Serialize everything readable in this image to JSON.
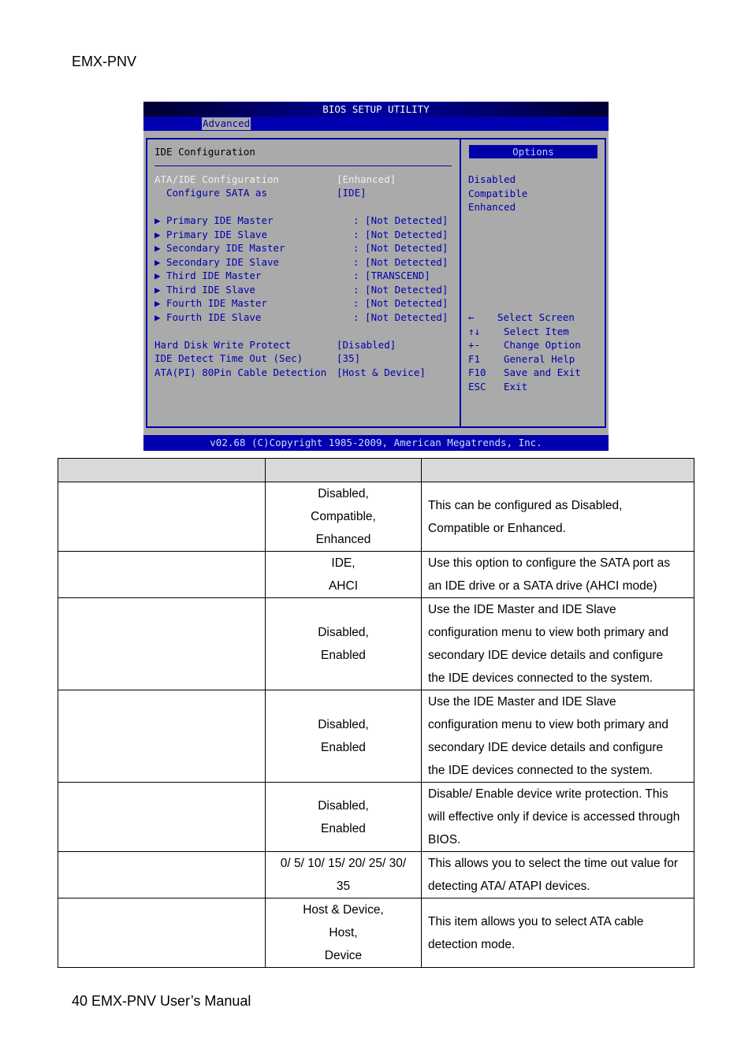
{
  "header": "EMX-PNV",
  "footer": "40 EMX-PNV User’s Manual",
  "bios": {
    "title": "BIOS SETUP UTILITY",
    "tab": "Advanced",
    "section_title": "IDE Configuration",
    "items": [
      {
        "label": "ATA/IDE Configuration",
        "value": "[Enhanced]",
        "selected": true
      },
      {
        "label": "  Configure SATA as",
        "value": "[IDE]"
      },
      {
        "label": "▶ Primary IDE Master",
        "value": ": [Not Detected]"
      },
      {
        "label": "▶ Primary IDE Slave",
        "value": ": [Not Detected]"
      },
      {
        "label": "▶ Secondary IDE Master",
        "value": ": [Not Detected]"
      },
      {
        "label": "▶ Secondary IDE Slave",
        "value": ": [Not Detected]"
      },
      {
        "label": "▶ Third IDE Master",
        "value": ": [TRANSCEND]"
      },
      {
        "label": "▶ Third IDE Slave",
        "value": ": [Not Detected]"
      },
      {
        "label": "▶ Fourth IDE Master",
        "value": ": [Not Detected]"
      },
      {
        "label": "▶ Fourth IDE Slave",
        "value": ": [Not Detected]"
      },
      {
        "label": "Hard Disk Write Protect",
        "value": "[Disabled]"
      },
      {
        "label": "IDE Detect Time Out (Sec)",
        "value": "[35]"
      },
      {
        "label": "ATA(PI) 80Pin Cable Detection",
        "value": "[Host & Device]"
      }
    ],
    "options_title": "Options",
    "options": [
      "Disabled",
      "Compatible",
      "Enhanced"
    ],
    "keys": [
      {
        "key": "←",
        "desc": "Select Screen"
      },
      {
        "key": "↑↓",
        "desc": "Select Item"
      },
      {
        "key": "+-",
        "desc": "Change Option"
      },
      {
        "key": "F1",
        "desc": "General Help"
      },
      {
        "key": "F10",
        "desc": "Save and Exit"
      },
      {
        "key": "ESC",
        "desc": "Exit"
      }
    ],
    "copyright": "v02.68 (C)Copyright 1985-2009, American Megatrends, Inc.",
    "colors": {
      "background": "#aaaaaa",
      "text_blue": "#0000aa",
      "bar_blue": "#0000b0"
    }
  },
  "table": {
    "rows": [
      {
        "setting": "",
        "options": [
          "Disabled,",
          "Compatible,",
          "Enhanced"
        ],
        "description": [
          "This can be configured as Disabled,",
          "Compatible or Enhanced."
        ]
      },
      {
        "setting": "",
        "options": [
          "IDE,",
          "AHCI"
        ],
        "description": [
          "Use this option to configure the SATA port as",
          "an IDE drive or a SATA drive (AHCI mode)"
        ]
      },
      {
        "setting": "",
        "options": [
          "Disabled,",
          "Enabled"
        ],
        "description": [
          "Use the IDE Master and IDE Slave",
          "configuration menu to view both primary and",
          "secondary IDE device details and configure",
          "the IDE devices connected to the system."
        ]
      },
      {
        "setting": "",
        "options": [
          "Disabled,",
          "Enabled"
        ],
        "description": [
          "Use the IDE Master and IDE Slave",
          "configuration menu to view both primary and",
          "secondary IDE device details and configure",
          "the IDE devices connected to the system."
        ]
      },
      {
        "setting": "",
        "options": [
          "Disabled,",
          "Enabled"
        ],
        "description": [
          "Disable/ Enable device write protection. This",
          "will effective only if device is accessed through",
          "BIOS."
        ]
      },
      {
        "setting": "",
        "options": [
          "0/ 5/ 10/ 15/ 20/ 25/ 30/",
          "35"
        ],
        "description": [
          "This allows you to select the time out value for",
          "detecting ATA/ ATAPI devices."
        ]
      },
      {
        "setting": "",
        "options": [
          "Host & Device,",
          "Host,",
          "Device"
        ],
        "description": [
          "This item allows you to select ATA cable",
          "detection mode."
        ]
      }
    ]
  }
}
